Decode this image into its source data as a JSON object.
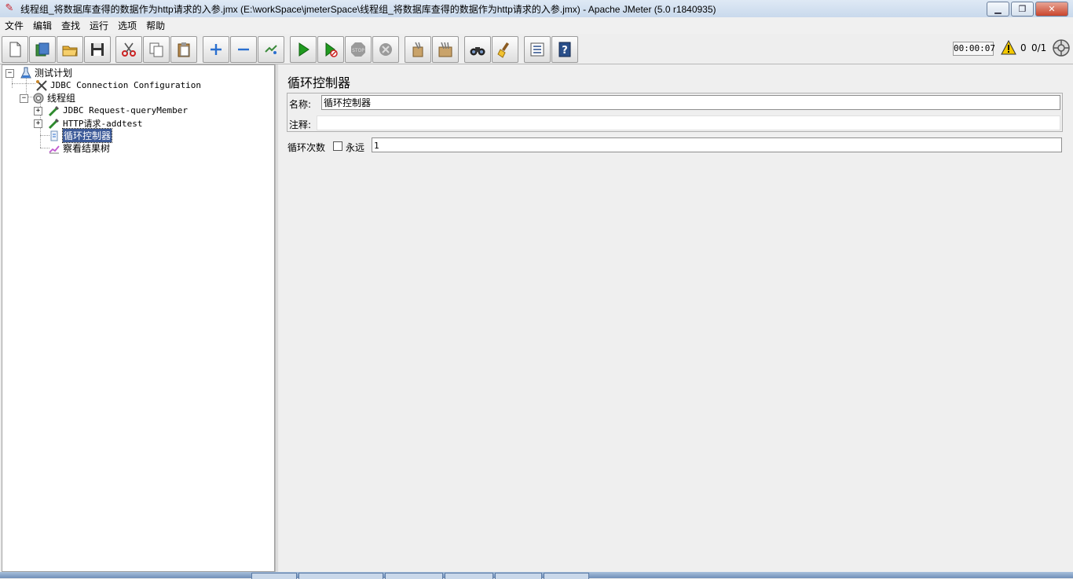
{
  "window": {
    "title": "线程组_将数据库查得的数据作为http请求的入参.jmx (E:\\workSpace\\jmeterSpace\\线程组_将数据库查得的数据作为http请求的入参.jmx) - Apache JMeter (5.0 r1840935)",
    "minimize": "▁",
    "maximize": "❐",
    "close": "✕"
  },
  "menu": [
    "文件",
    "编辑",
    "查找",
    "运行",
    "选项",
    "帮助"
  ],
  "toolbar": {
    "timer": "00:00:07",
    "warning_count": "0",
    "thread_count": "0/1",
    "icons": [
      "new-icon",
      "templates-icon",
      "open-icon",
      "save-icon",
      "cut-icon",
      "copy-icon",
      "paste-icon",
      "expand-icon",
      "collapse-icon",
      "toggle-icon",
      "start-icon",
      "start-no-pause-icon",
      "stop-icon",
      "shutdown-icon",
      "clear-icon",
      "clear-all-icon",
      "search-icon",
      "reset-search-icon",
      "function-helper-icon",
      "help-icon"
    ]
  },
  "tree": {
    "test_plan": "测试计划",
    "jdbc_config": "JDBC Connection Configuration",
    "thread_group": "线程组",
    "jdbc_request": "JDBC Request-queryMember",
    "http_request": "HTTP请求-addtest",
    "loop_controller": "循环控制器",
    "results_tree": "察看结果树"
  },
  "panel": {
    "title": "循环控制器",
    "name_label": "名称:",
    "name_value": "循环控制器",
    "comment_label": "注释:",
    "comment_value": "",
    "loop_label": "循环次数",
    "forever_label": "永远",
    "loop_value": "1"
  },
  "colors": {
    "selection": "#3b5998",
    "title_bar": "#c9d9ec"
  }
}
